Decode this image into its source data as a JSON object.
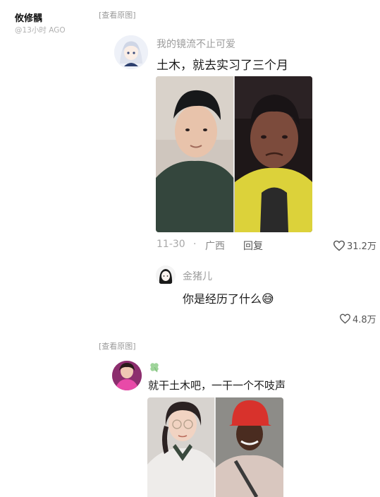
{
  "post": {
    "author": "攸修髃",
    "time_ago": "@13小时 AGO"
  },
  "shots": [
    {
      "view_original": "[查看原图]",
      "comment": {
        "username": "我的镜流不止可爱",
        "text": "土木，就去实习了三个月",
        "date": "11-30",
        "separator": "·",
        "location": "广西",
        "reply_label": "回复",
        "likes": "31.2万"
      },
      "reply": {
        "username": "金猪儿",
        "text": "你是经历了什么",
        "emoji": "😅",
        "likes": "4.8万"
      }
    },
    {
      "view_original": "[查看原图]",
      "comment": {
        "username_icon": "clover-icon",
        "text": "就干土木吧，一干一个不吱声"
      }
    }
  ],
  "colors": {
    "meta_gray": "#a8a8a8",
    "vest_yellow": "#e6e03a",
    "helmet_red": "#d8322c"
  }
}
